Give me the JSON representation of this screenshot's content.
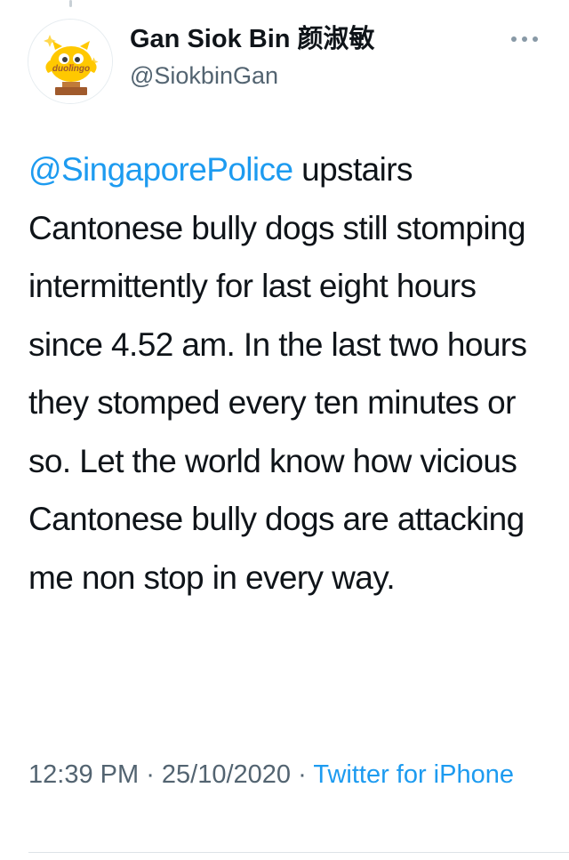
{
  "author": {
    "display_name": "Gan Siok Bin 颜淑敏",
    "handle": "@SiokbinGan",
    "avatar_text": "duolingo",
    "avatar_icon": "duolingo-owl-icon"
  },
  "menu": {
    "icon": "more-dots-icon",
    "label": "···"
  },
  "tweet": {
    "mention": "@SingaporePolice",
    "body": " upstairs Cantonese bully dogs still stomping intermittently for last eight hours since 4.52 am. In the last two hours they stomped every ten minutes or so. Let the world know how vicious Cantonese bully dogs are attacking me non stop in every way."
  },
  "meta": {
    "time": "12:39 PM",
    "sep1": " · ",
    "date": "25/10/2020",
    "sep2": " · ",
    "source": "Twitter for iPhone"
  },
  "colors": {
    "link": "#1d9bf0",
    "secondary_text": "#536471",
    "avatar_yellow": "#ffc800",
    "avatar_brown": "#a05a2c"
  }
}
